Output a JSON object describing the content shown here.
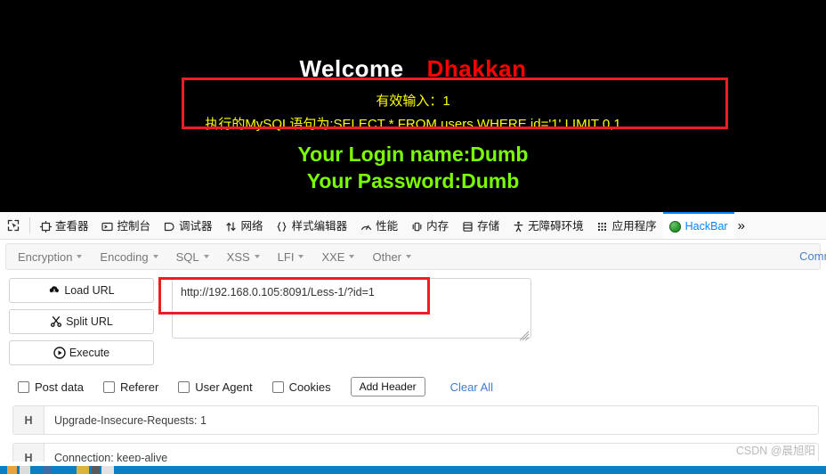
{
  "page": {
    "heading_welcome": "Welcome",
    "heading_name": "Dhakkan",
    "valid_input_line": "有效输入：1",
    "sql_line": "执行的MySQL语句为:SELECT * FROM users WHERE id='1' LIMIT 0,1",
    "login_name_line": "Your Login name:Dumb",
    "password_line": "Your Password:Dumb",
    "colors": {
      "background": "#000000",
      "welcome": "#ffffff",
      "name": "#ff0000",
      "info": "#ffff00",
      "credentials": "#7cfc00",
      "annotation": "#ee1c25"
    }
  },
  "devtools": {
    "picker_icon": "element-picker-icon",
    "tabs": [
      {
        "label": "查看器",
        "icon": "inspector-icon",
        "active": false
      },
      {
        "label": "控制台",
        "icon": "console-icon",
        "active": false
      },
      {
        "label": "调试器",
        "icon": "debugger-icon",
        "active": false
      },
      {
        "label": "网络",
        "icon": "network-icon",
        "active": false
      },
      {
        "label": "样式编辑器",
        "icon": "style-editor-icon",
        "active": false
      },
      {
        "label": "性能",
        "icon": "performance-icon",
        "active": false
      },
      {
        "label": "内存",
        "icon": "memory-icon",
        "active": false
      },
      {
        "label": "存储",
        "icon": "storage-icon",
        "active": false
      },
      {
        "label": "无障碍环境",
        "icon": "accessibility-icon",
        "active": false
      },
      {
        "label": "应用程序",
        "icon": "application-icon",
        "active": false
      },
      {
        "label": "HackBar",
        "icon": "hackbar-icon",
        "active": true
      }
    ],
    "overflow_label": "»",
    "active_tab_color": "#0a84ff"
  },
  "hackbar": {
    "menus": [
      {
        "label": "Encryption"
      },
      {
        "label": "Encoding"
      },
      {
        "label": "SQL"
      },
      {
        "label": "XSS"
      },
      {
        "label": "LFI"
      },
      {
        "label": "XXE"
      },
      {
        "label": "Other"
      }
    ],
    "commit_label": "Commit no",
    "actions": [
      {
        "label": "Load URL",
        "icon": "cloud-download-icon"
      },
      {
        "label": "Split URL",
        "icon": "scissors-icon"
      },
      {
        "label": "Execute",
        "icon": "play-icon"
      }
    ],
    "url_value": "http://192.168.0.105:8091/Less-1/?id=1",
    "url_placeholder": "",
    "checkboxes": [
      {
        "label": "Post data",
        "checked": false
      },
      {
        "label": "Referer",
        "checked": false
      },
      {
        "label": "User Agent",
        "checked": false
      },
      {
        "label": "Cookies",
        "checked": false
      }
    ],
    "add_header_label": "Add Header",
    "clear_all_label": "Clear All",
    "headers": [
      {
        "tag": "H",
        "value": "Upgrade-Insecure-Requests: 1"
      },
      {
        "tag": "H",
        "value": "Connection: keep-alive"
      }
    ]
  },
  "watermark": "CSDN @晨旭阳"
}
